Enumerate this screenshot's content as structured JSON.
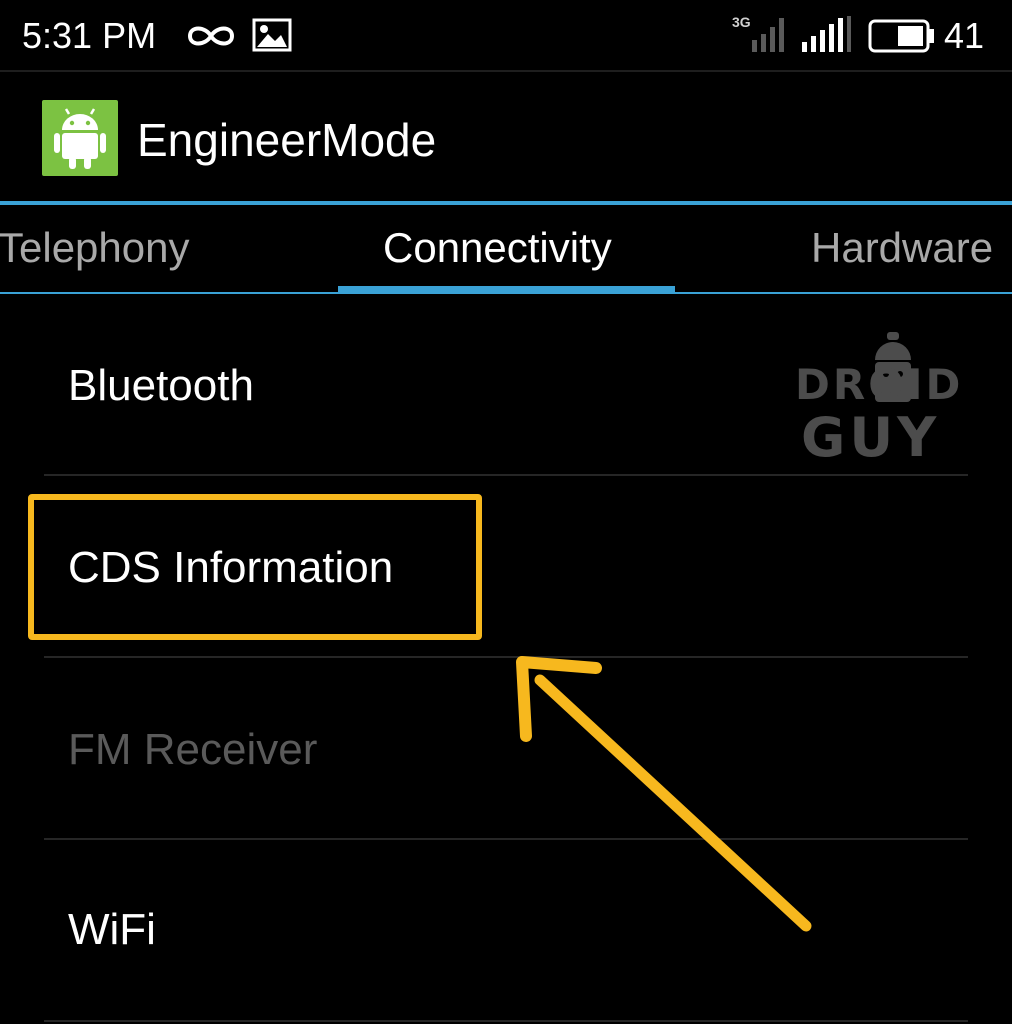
{
  "status_bar": {
    "time": "5:31 PM",
    "icons": [
      "infinity-icon",
      "image-notification-icon",
      "signal-3g-icon",
      "signal-bars-icon",
      "battery-icon"
    ],
    "network_type": "3G",
    "battery_percent": "41"
  },
  "action_bar": {
    "app_icon": "android-robot-icon",
    "title": "EngineerMode"
  },
  "tabs": [
    {
      "label": "Telephony",
      "selected": false
    },
    {
      "label": "Connectivity",
      "selected": true
    },
    {
      "label": "Hardware",
      "selected": false
    }
  ],
  "list": {
    "items": [
      {
        "label": "Bluetooth",
        "enabled": true
      },
      {
        "label": "CDS Information",
        "enabled": true,
        "highlighted": true
      },
      {
        "label": "FM Receiver",
        "enabled": false
      },
      {
        "label": "WiFi",
        "enabled": true
      }
    ]
  },
  "annotation": {
    "highlight_color": "#f7b81e",
    "arrow_color": "#f7b81e"
  },
  "watermark": {
    "line1": "DROID",
    "line2": "GUY"
  },
  "colors": {
    "accent": "#3aa2d6",
    "background": "#000000",
    "app_icon_bg": "#7cc242",
    "disabled_text": "#5a5a5a"
  }
}
